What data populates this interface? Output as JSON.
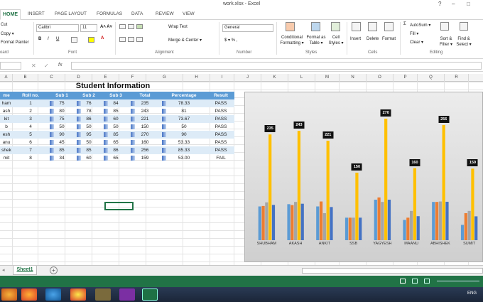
{
  "window": {
    "title": "work.xlsx - Excel",
    "help": "?",
    "minimize": "–",
    "restore": "□"
  },
  "tabs": [
    "HOME",
    "INSERT",
    "PAGE LAYOUT",
    "FORMULAS",
    "DATA",
    "REVIEW",
    "VIEW"
  ],
  "ribbon": {
    "cut": "Cut",
    "copy": "Copy ▾",
    "format_painter": "Format Painter",
    "font_name": "Calibri",
    "font_size": "11",
    "wrap_text": "Wrap Text",
    "merge_center": "Merge & Center ▾",
    "number_format": "General",
    "currency": "$ ▾ %  ,",
    "cond_format": "Conditional Formatting ▾",
    "format_table": "Format as Table ▾",
    "cell_styles": "Cell Styles ▾",
    "insert": "Insert",
    "delete": "Delete",
    "format": "Format",
    "autosum": "AutoSum ▾",
    "fill": "Fill ▾",
    "clear": "Clear ▾",
    "sort_filter": "Sort & Filter ▾",
    "find_select": "Find & Select ▾",
    "groups": {
      "clipboard": "oard",
      "font": "Font",
      "alignment": "Alignment",
      "number": "Number",
      "styles": "Styles",
      "cells": "Cells",
      "editing": "Editing"
    }
  },
  "columns": [
    "A",
    "B",
    "C",
    "D",
    "E",
    "F",
    "G",
    "H",
    "I",
    "J",
    "K",
    "L",
    "M",
    "N",
    "O",
    "P",
    "Q",
    "R"
  ],
  "sheet": {
    "title": "Student Information",
    "headers": [
      "me",
      "Roll no.",
      "Sub 1",
      "Sub 2",
      "Sub 3",
      "Total",
      "Percentage",
      "Result"
    ],
    "rows": [
      [
        "ham",
        "1",
        "75",
        "76",
        "84",
        "235",
        "78.33",
        "PASS"
      ],
      [
        "ash",
        "2",
        "80",
        "78",
        "85",
        "243",
        "81",
        "PASS"
      ],
      [
        "kit",
        "3",
        "75",
        "86",
        "60",
        "221",
        "73.67",
        "PASS"
      ],
      [
        "b",
        "4",
        "50",
        "50",
        "50",
        "150",
        "50",
        "PASS"
      ],
      [
        "esh",
        "5",
        "90",
        "95",
        "85",
        "270",
        "90",
        "PASS"
      ],
      [
        "anu",
        "6",
        "45",
        "50",
        "65",
        "160",
        "53.33",
        "PASS"
      ],
      [
        "shek",
        "7",
        "85",
        "85",
        "86",
        "256",
        "85.33",
        "PASS"
      ],
      [
        "mit",
        "8",
        "34",
        "60",
        "65",
        "159",
        "53.00",
        "FAIL"
      ]
    ]
  },
  "chart_data": {
    "type": "bar",
    "categories": [
      "SHUBHAM",
      "AKASH",
      "ANKIT",
      "SSB",
      "YAGYESH",
      "MAANU",
      "ABHISHEK",
      "SUMIT"
    ],
    "series": [
      {
        "name": "Sub 1",
        "values": [
          75,
          80,
          75,
          50,
          90,
          45,
          85,
          34
        ],
        "color": "#5b9bd5"
      },
      {
        "name": "Sub 2",
        "values": [
          76,
          78,
          86,
          50,
          95,
          50,
          85,
          60
        ],
        "color": "#ed7d31"
      },
      {
        "name": "Sub 3",
        "values": [
          84,
          85,
          60,
          50,
          85,
          65,
          86,
          65
        ],
        "color": "#a5a5a5"
      },
      {
        "name": "Total",
        "values": [
          235,
          243,
          221,
          150,
          270,
          160,
          256,
          159
        ],
        "color": "#ffc000"
      },
      {
        "name": "Percentage",
        "values": [
          78.33,
          81,
          73.67,
          50,
          90,
          53.33,
          85.33,
          53
        ],
        "color": "#4472c4"
      }
    ],
    "data_labels": [
      "235",
      "243",
      "221",
      "150",
      "270",
      "160",
      "256",
      "159"
    ],
    "ylim": [
      0,
      300
    ]
  },
  "sheet_tabs": [
    "Sheet1"
  ],
  "status": {
    "lang": "ENG"
  }
}
